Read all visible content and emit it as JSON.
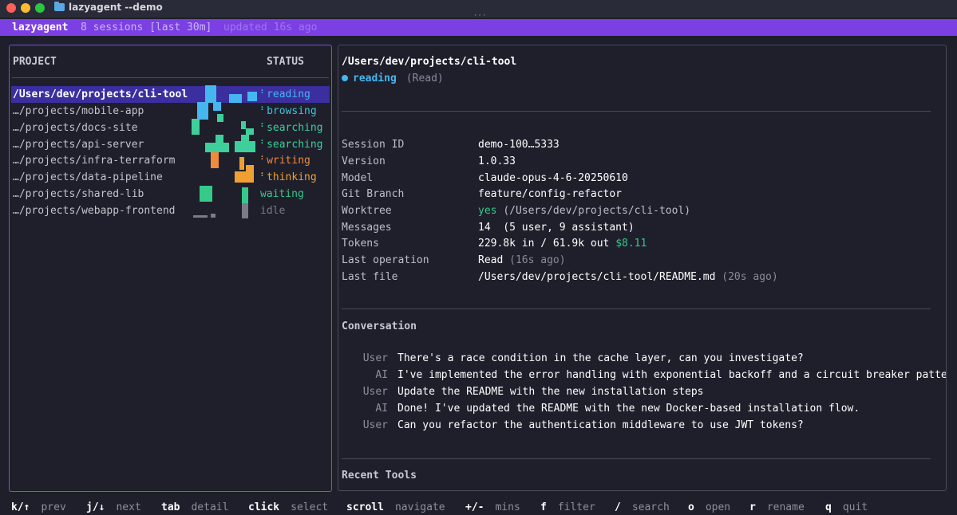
{
  "window": {
    "title": "lazyagent --demo"
  },
  "header": {
    "app_name": "lazyagent",
    "sessions": "8 sessions [last 30m]",
    "updated": "updated 16s ago"
  },
  "colors": {
    "accent": "#7b3fe4",
    "reading": "#45b6f0",
    "browsing": "#3ec4d8",
    "searching": "#3ecf9a",
    "writing": "#f08a3c",
    "thinking": "#f0a032",
    "waiting": "#35c98a",
    "idle": "#7a7a88"
  },
  "list": {
    "col_project": "PROJECT",
    "col_status": "STATUS",
    "rows": [
      {
        "project": "/Users/dev/projects/cli-tool",
        "status": "reading",
        "color": "#45b6f0",
        "spinner": "⠆"
      },
      {
        "project": "…/projects/mobile-app",
        "status": "browsing",
        "color": "#3ec4d8",
        "spinner": "⠆"
      },
      {
        "project": "…/projects/docs-site",
        "status": "searching",
        "color": "#3ecf9a",
        "spinner": "⠆"
      },
      {
        "project": "…/projects/api-server",
        "status": "searching",
        "color": "#3ecf9a",
        "spinner": "⠆"
      },
      {
        "project": "…/projects/infra-terraform",
        "status": "writing",
        "color": "#f08a3c",
        "spinner": "⠆"
      },
      {
        "project": "…/projects/data-pipeline",
        "status": "thinking",
        "color": "#f0a032",
        "spinner": "⠆"
      },
      {
        "project": "…/projects/shared-lib",
        "status": "waiting",
        "color": "#35c98a",
        "spinner": ""
      },
      {
        "project": "…/projects/webapp-frontend",
        "status": "idle",
        "color": "#7a7a88",
        "spinner": ""
      }
    ]
  },
  "detail": {
    "path": "/Users/dev/projects/cli-tool",
    "state": "reading",
    "state_op": "(Read)",
    "session_id_label": "Session ID",
    "session_id": "demo-100…5333",
    "version_label": "Version",
    "version": "1.0.33",
    "model_label": "Model",
    "model": "claude-opus-4-6-20250610",
    "branch_label": "Git Branch",
    "branch": "feature/config-refactor",
    "worktree_label": "Worktree",
    "worktree_yes": "yes",
    "worktree_path": "(/Users/dev/projects/cli-tool)",
    "messages_label": "Messages",
    "messages": "14  (5 user, 9 assistant)",
    "tokens_label": "Tokens",
    "tokens": "229.8k in / 61.9k out",
    "cost": "$8.11",
    "lastop_label": "Last operation",
    "lastop": "Read",
    "lastop_ago": "(16s ago)",
    "lastfile_label": "Last file",
    "lastfile": "/Users/dev/projects/cli-tool/README.md",
    "lastfile_ago": "(20s ago)",
    "conversation_title": "Conversation",
    "conversation": [
      {
        "role": "User",
        "text": "There's a race condition in the cache layer, can you investigate?"
      },
      {
        "role": "AI",
        "text": "I've implemented the error handling with exponential backoff and a circuit breaker patte…"
      },
      {
        "role": "User",
        "text": "Update the README with the new installation steps"
      },
      {
        "role": "AI",
        "text": "Done! I've updated the README with the new Docker-based installation flow."
      },
      {
        "role": "User",
        "text": "Can you refactor the authentication middleware to use JWT tokens?"
      }
    ],
    "recent_tools_title": "Recent Tools"
  },
  "footer": [
    {
      "key": "k/↑",
      "desc": "prev"
    },
    {
      "key": "j/↓",
      "desc": "next"
    },
    {
      "key": "tab",
      "desc": "detail"
    },
    {
      "key": "click",
      "desc": "select"
    },
    {
      "key": "scroll",
      "desc": "navigate"
    },
    {
      "key": "+/-",
      "desc": "mins"
    },
    {
      "key": "f",
      "desc": "filter"
    },
    {
      "key": "/",
      "desc": "search"
    },
    {
      "key": "o",
      "desc": "open"
    },
    {
      "key": "r",
      "desc": "rename"
    },
    {
      "key": "q",
      "desc": "quit"
    }
  ]
}
